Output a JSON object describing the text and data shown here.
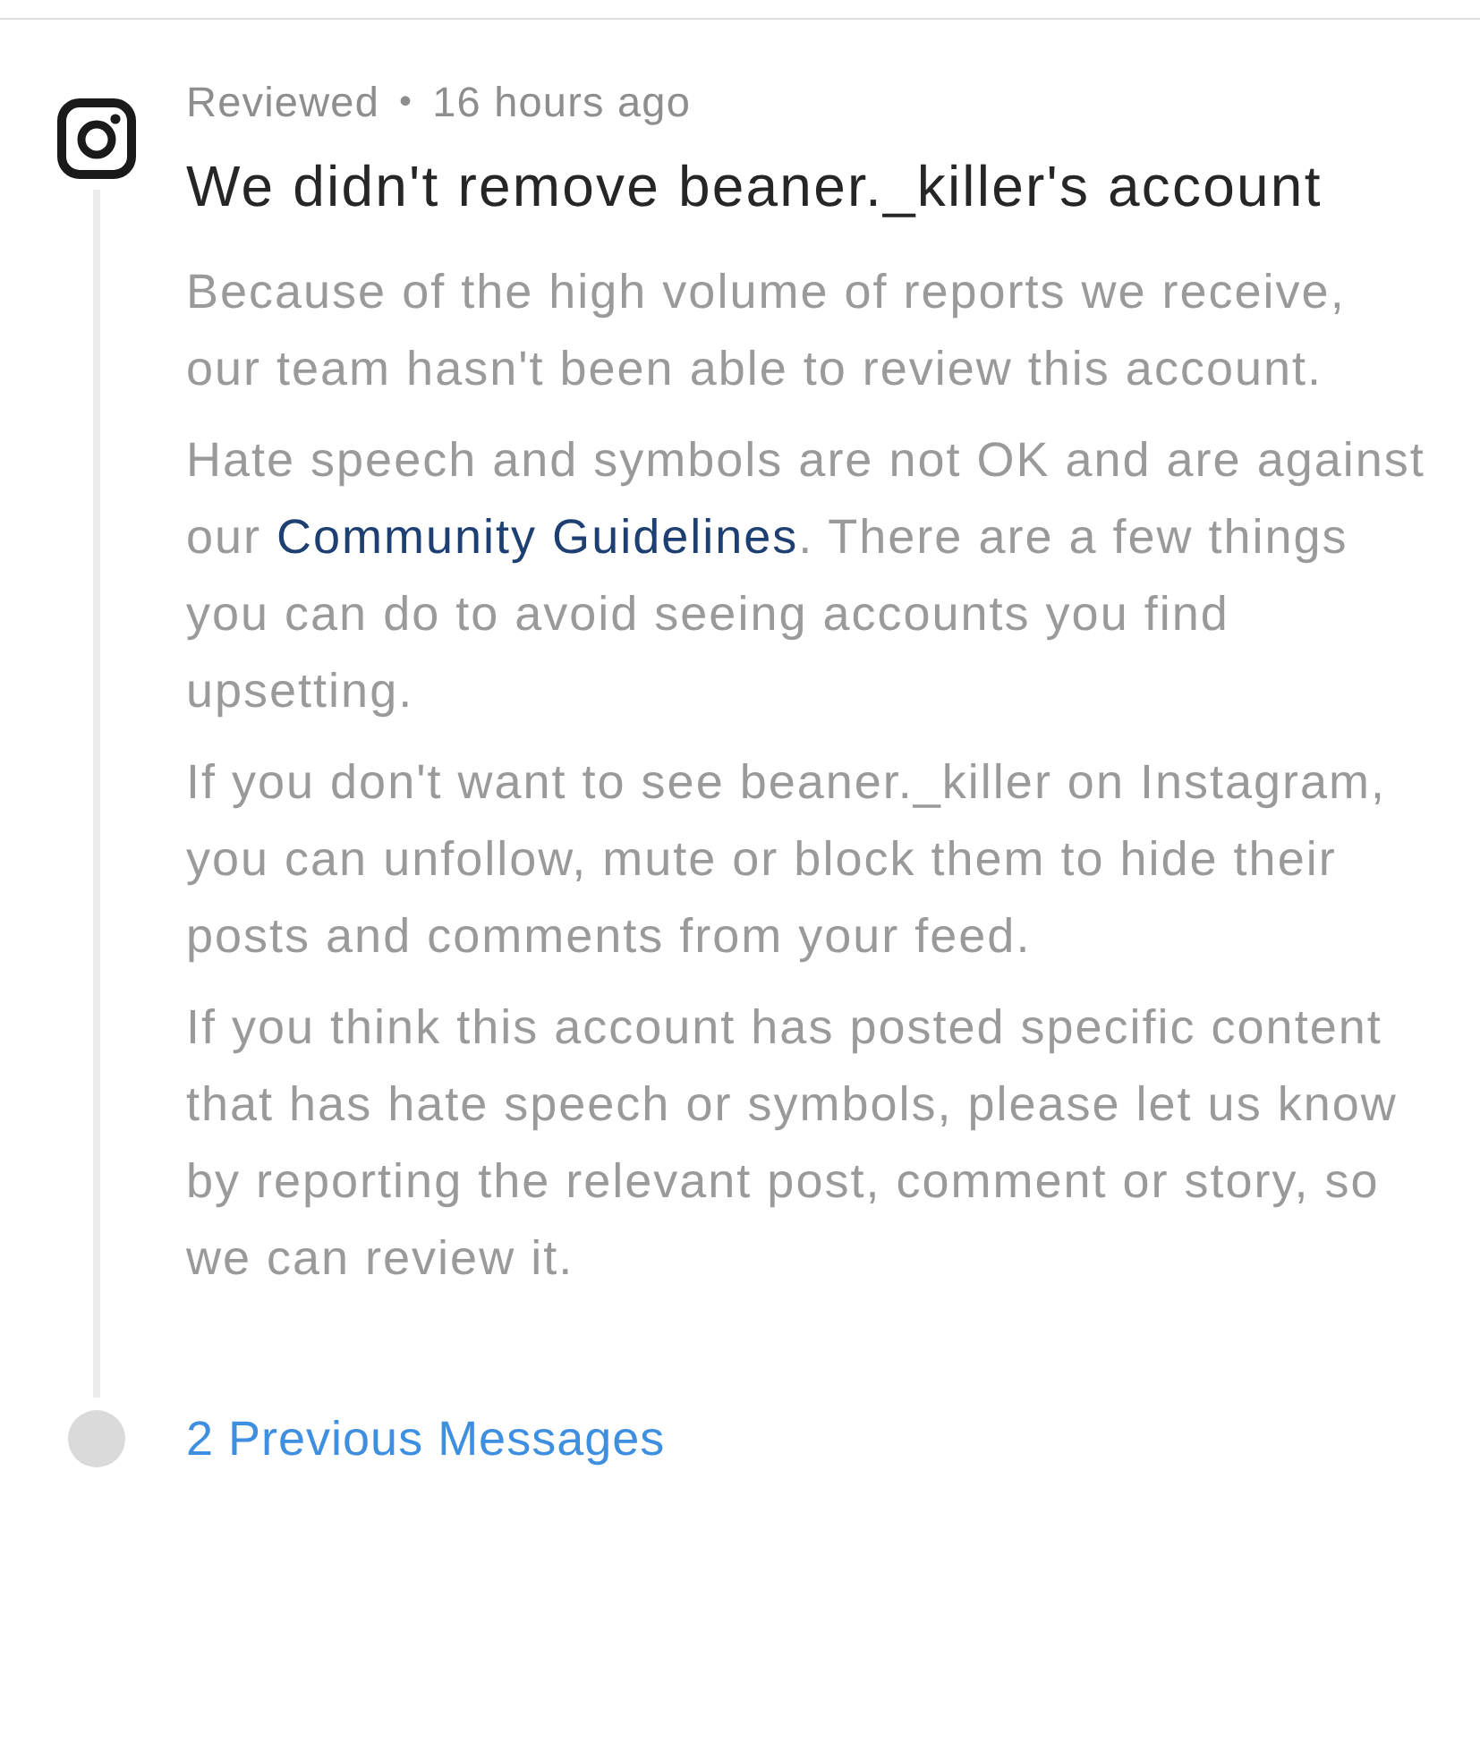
{
  "entry": {
    "status": "Reviewed",
    "separator": "•",
    "time": "16 hours ago",
    "title": "We didn't remove beaner._killer's account",
    "paragraphs": [
      {
        "parts": [
          {
            "kind": "text",
            "text": "Because of the high volume of reports we receive, our team hasn't been able to review this account."
          }
        ]
      },
      {
        "parts": [
          {
            "kind": "text",
            "text": "Hate speech and symbols are not OK and are against our "
          },
          {
            "kind": "link",
            "text": "Community Guidelines"
          },
          {
            "kind": "text",
            "text": ". There are a few things you can do to avoid seeing accounts you find upsetting."
          }
        ]
      },
      {
        "parts": [
          {
            "kind": "text",
            "text": "If you don't want to see beaner._killer on Instagram, you can unfollow, mute or block them to hide their posts and comments from your feed."
          }
        ]
      },
      {
        "parts": [
          {
            "kind": "text",
            "text": "If you think this account has posted specific content that has hate speech or symbols, please let us know by reporting the relevant post, comment or story, so we can review it."
          }
        ]
      }
    ]
  },
  "previous": {
    "label": "2 Previous Messages"
  }
}
